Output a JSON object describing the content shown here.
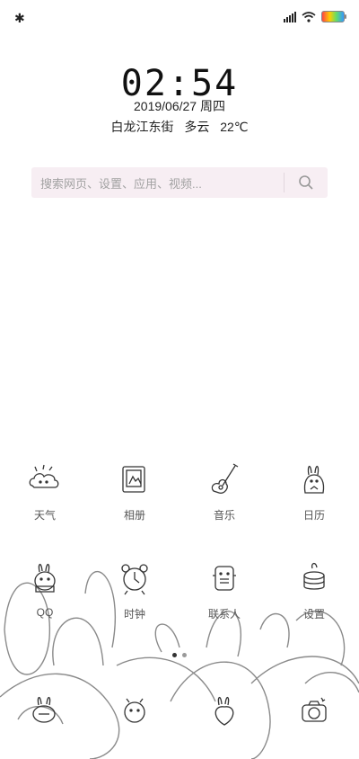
{
  "status": {
    "bluetooth_icon": "bluetooth-icon",
    "signal_icon": "signal-icon",
    "wifi_icon": "wifi-icon",
    "battery_icon": "battery-icon"
  },
  "lock": {
    "time": "02:54",
    "date": "2019/06/27",
    "weekday": "周四",
    "location": "白龙江东街",
    "condition": "多云",
    "temperature": "22℃"
  },
  "search": {
    "placeholder": "搜索网页、设置、应用、视频..."
  },
  "apps_row1": [
    {
      "label": "天气",
      "icon": "weather-icon"
    },
    {
      "label": "相册",
      "icon": "gallery-icon"
    },
    {
      "label": "音乐",
      "icon": "music-icon"
    },
    {
      "label": "日历",
      "icon": "calendar-icon"
    }
  ],
  "apps_row2": [
    {
      "label": "QQ",
      "icon": "qq-icon"
    },
    {
      "label": "时钟",
      "icon": "clock-icon"
    },
    {
      "label": "联系人",
      "icon": "contacts-icon"
    },
    {
      "label": "设置",
      "icon": "settings-icon"
    }
  ],
  "dock": [
    {
      "icon": "phone-icon"
    },
    {
      "icon": "messages-icon"
    },
    {
      "icon": "browser-icon"
    },
    {
      "icon": "camera-icon"
    }
  ],
  "pager": {
    "active_color": "#333333",
    "inactive_color": "#999999"
  }
}
